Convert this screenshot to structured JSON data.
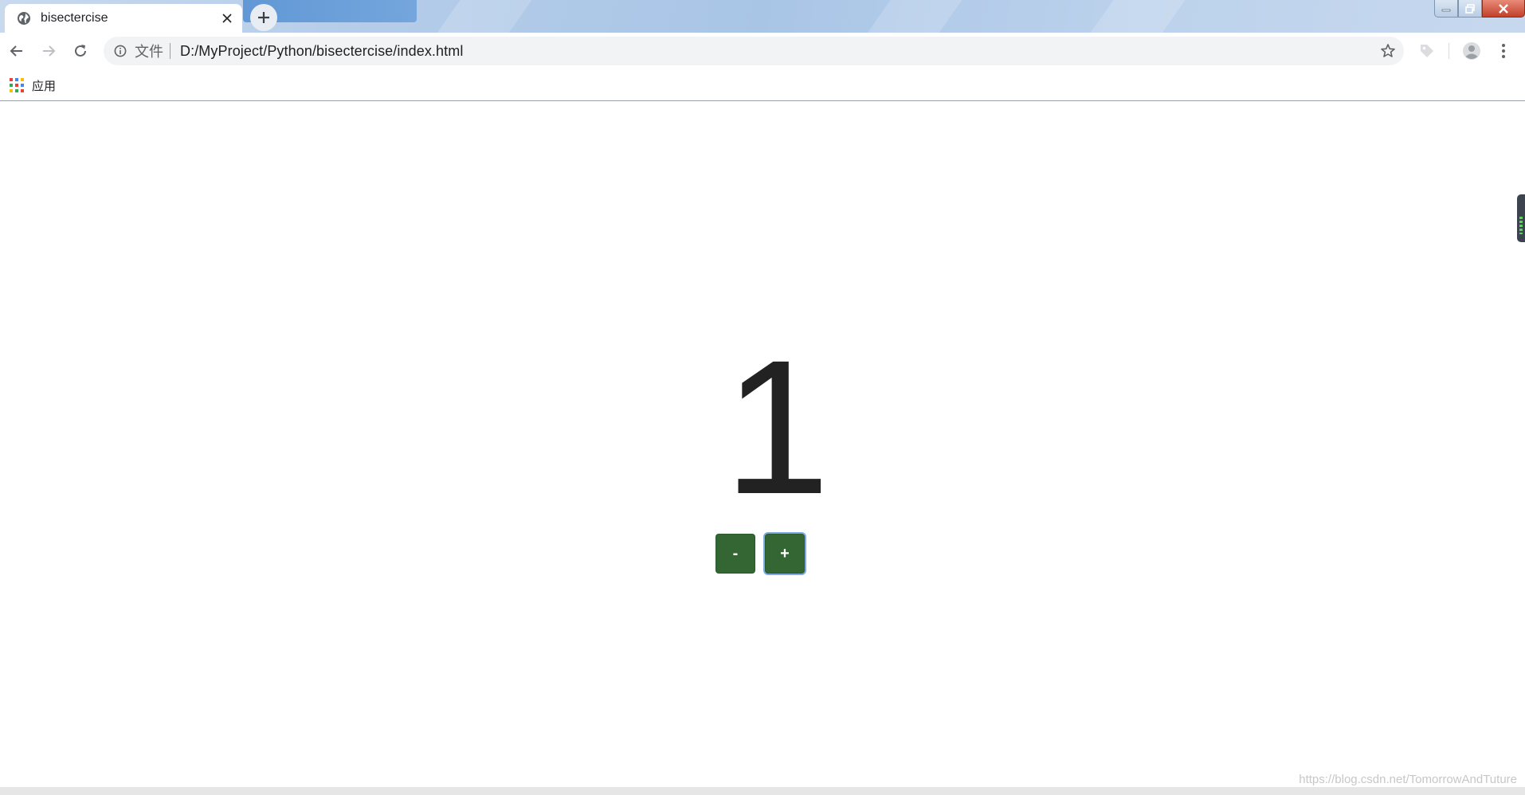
{
  "window": {
    "controls": [
      "minimize-icon",
      "restore-icon",
      "close-icon"
    ],
    "close_color": "#c2412a"
  },
  "tabs": [
    {
      "title": "bisectercise",
      "active": true,
      "icon": "globe-icon"
    }
  ],
  "toolbar": {
    "back_icon": "arrow-left-icon",
    "forward_icon": "arrow-right-icon",
    "reload_icon": "reload-icon",
    "omnibox": {
      "scheme_label": "文件",
      "url": "D:/MyProject/Python/bisectercise/index.html",
      "info_icon": "info-icon",
      "bookmark_icon": "star-icon"
    },
    "extension_icon": "tag-icon",
    "profile_icon": "profile-icon",
    "menu_icon": "more-vert-icon"
  },
  "bookmarks_bar": {
    "apps_label": "应用",
    "apps_icon": "apps-grid-icon"
  },
  "page": {
    "counter_value": "1",
    "decrement_label": "-",
    "increment_label": "+",
    "button_color": "#336633",
    "focused_button": "increment"
  },
  "watermark": "https://blog.csdn.net/TomorrowAndTuture"
}
